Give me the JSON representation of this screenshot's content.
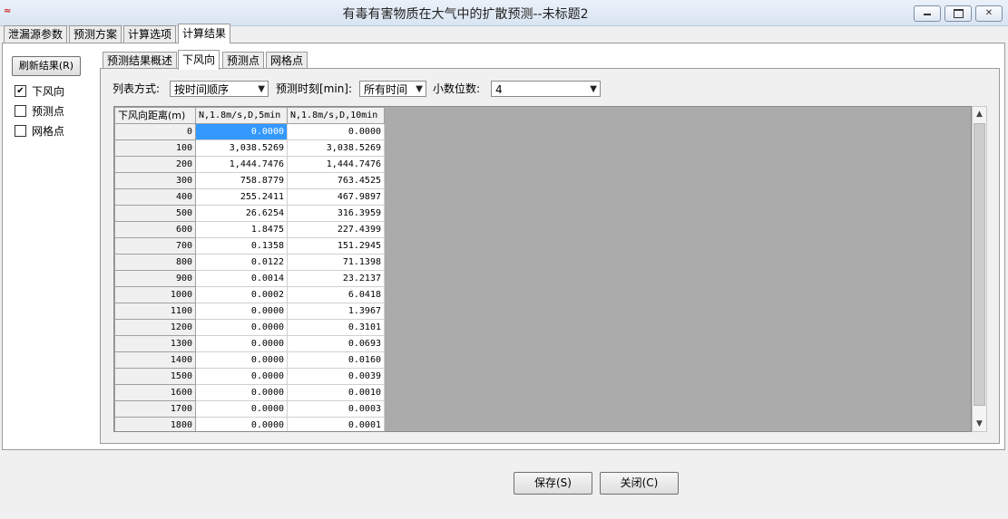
{
  "window": {
    "title": "有毒有害物质在大气中的扩散预测--未标题2",
    "app_icon_text": "≈"
  },
  "main_tabs": [
    {
      "label": "泄漏源参数",
      "active": false
    },
    {
      "label": "预测方案",
      "active": false
    },
    {
      "label": "计算选项",
      "active": false
    },
    {
      "label": "计算结果",
      "active": true
    }
  ],
  "left_panel": {
    "refresh_label": "刷新结果(R)",
    "checkboxes": [
      {
        "label": "下风向",
        "checked": true
      },
      {
        "label": "预测点",
        "checked": false
      },
      {
        "label": "网格点",
        "checked": false
      }
    ]
  },
  "sub_tabs": [
    {
      "label": "预测结果概述",
      "active": false
    },
    {
      "label": "下风向",
      "active": true
    },
    {
      "label": "预测点",
      "active": false
    },
    {
      "label": "网格点",
      "active": false
    }
  ],
  "options": {
    "list_mode_label": "列表方式:",
    "list_mode_value": "按时间顺序",
    "time_label": "预测时刻[min]:",
    "time_value": "所有时间",
    "decimals_label": "小数位数:",
    "decimals_value": "4"
  },
  "grid": {
    "headers": [
      "下风向距离(m)",
      "N,1.8m/s,D,5min",
      "N,1.8m/s,D,10min"
    ],
    "rows": [
      [
        "0",
        "0.0000",
        "0.0000"
      ],
      [
        "100",
        "3,038.5269",
        "3,038.5269"
      ],
      [
        "200",
        "1,444.7476",
        "1,444.7476"
      ],
      [
        "300",
        "758.8779",
        "763.4525"
      ],
      [
        "400",
        "255.2411",
        "467.9897"
      ],
      [
        "500",
        "26.6254",
        "316.3959"
      ],
      [
        "600",
        "1.8475",
        "227.4399"
      ],
      [
        "700",
        "0.1358",
        "151.2945"
      ],
      [
        "800",
        "0.0122",
        "71.1398"
      ],
      [
        "900",
        "0.0014",
        "23.2137"
      ],
      [
        "1000",
        "0.0002",
        "6.0418"
      ],
      [
        "1100",
        "0.0000",
        "1.3967"
      ],
      [
        "1200",
        "0.0000",
        "0.3101"
      ],
      [
        "1300",
        "0.0000",
        "0.0693"
      ],
      [
        "1400",
        "0.0000",
        "0.0160"
      ],
      [
        "1500",
        "0.0000",
        "0.0039"
      ],
      [
        "1600",
        "0.0000",
        "0.0010"
      ],
      [
        "1700",
        "0.0000",
        "0.0003"
      ],
      [
        "1800",
        "0.0000",
        "0.0001"
      ]
    ]
  },
  "buttons": {
    "save": "保存(S)",
    "close": "关闭(C)"
  },
  "colors": {
    "selection": "#3399ff",
    "grid_empty": "#ababab"
  }
}
